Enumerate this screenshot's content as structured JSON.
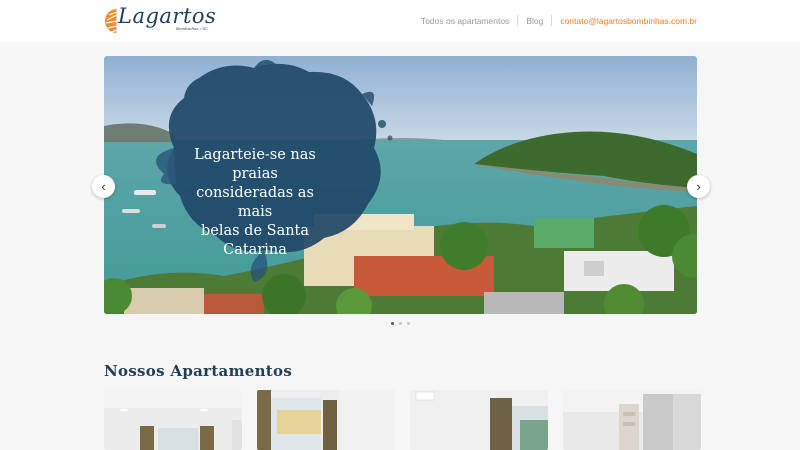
{
  "brand": {
    "name": "Lagartos",
    "tagline": "Bombinhas / SC"
  },
  "nav": {
    "item_apartments": "Todos os apartamentos",
    "item_blog": "Blog",
    "item_email": "contato@lagartosbombinhas.com.br"
  },
  "slider": {
    "caption_line1": "Lagarteie-se nas praias",
    "caption_line2": "consideradas as mais",
    "caption_line3": "belas de Santa Catarina",
    "prev_icon": "chevron-left-icon",
    "next_icon": "chevron-right-icon",
    "slide_count": 3,
    "active_slide": 1
  },
  "apartments": {
    "title": "Nossos Apartamentos",
    "cards": [
      {
        "image": "apartment-interior-1"
      },
      {
        "image": "apartment-interior-2"
      },
      {
        "image": "apartment-interior-3"
      },
      {
        "image": "apartment-interior-4"
      }
    ]
  },
  "colors": {
    "accent": "#f07c22",
    "brand_blue": "#1e3f5a",
    "nav_text": "#9a9a9a"
  }
}
